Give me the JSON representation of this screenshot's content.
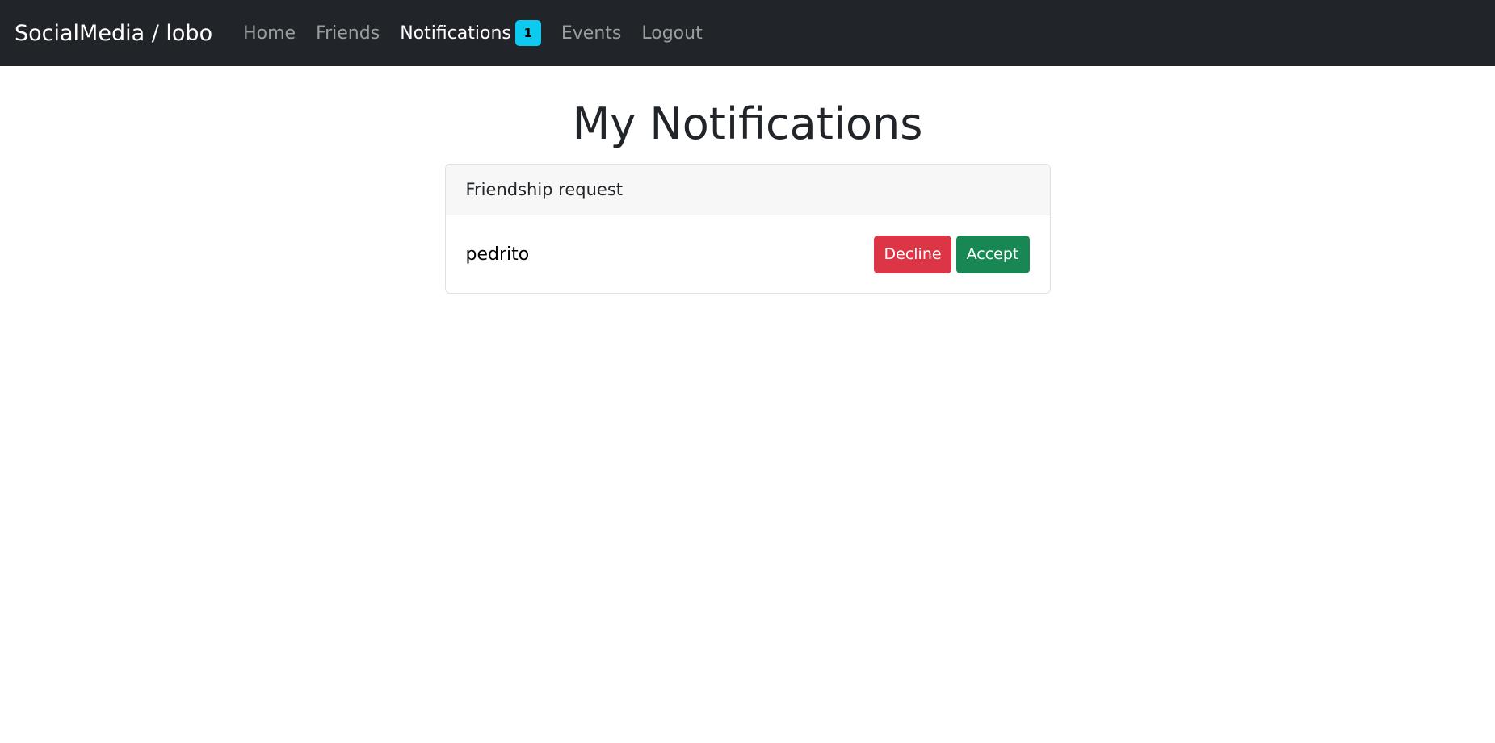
{
  "navbar": {
    "brand": "SocialMedia / lobo",
    "links": [
      {
        "label": "Home"
      },
      {
        "label": "Friends"
      },
      {
        "label": "Notifications",
        "badge": "1"
      },
      {
        "label": "Events"
      },
      {
        "label": "Logout"
      }
    ]
  },
  "main": {
    "title": "My Notifications",
    "notifications": [
      {
        "header": "Friendship request",
        "username": "pedrito",
        "decline_label": "Decline",
        "accept_label": "Accept"
      }
    ]
  },
  "colors": {
    "navbar_bg": "#212529",
    "badge": "#0dcaf0",
    "decline": "#dc3545",
    "accept": "#198754"
  }
}
